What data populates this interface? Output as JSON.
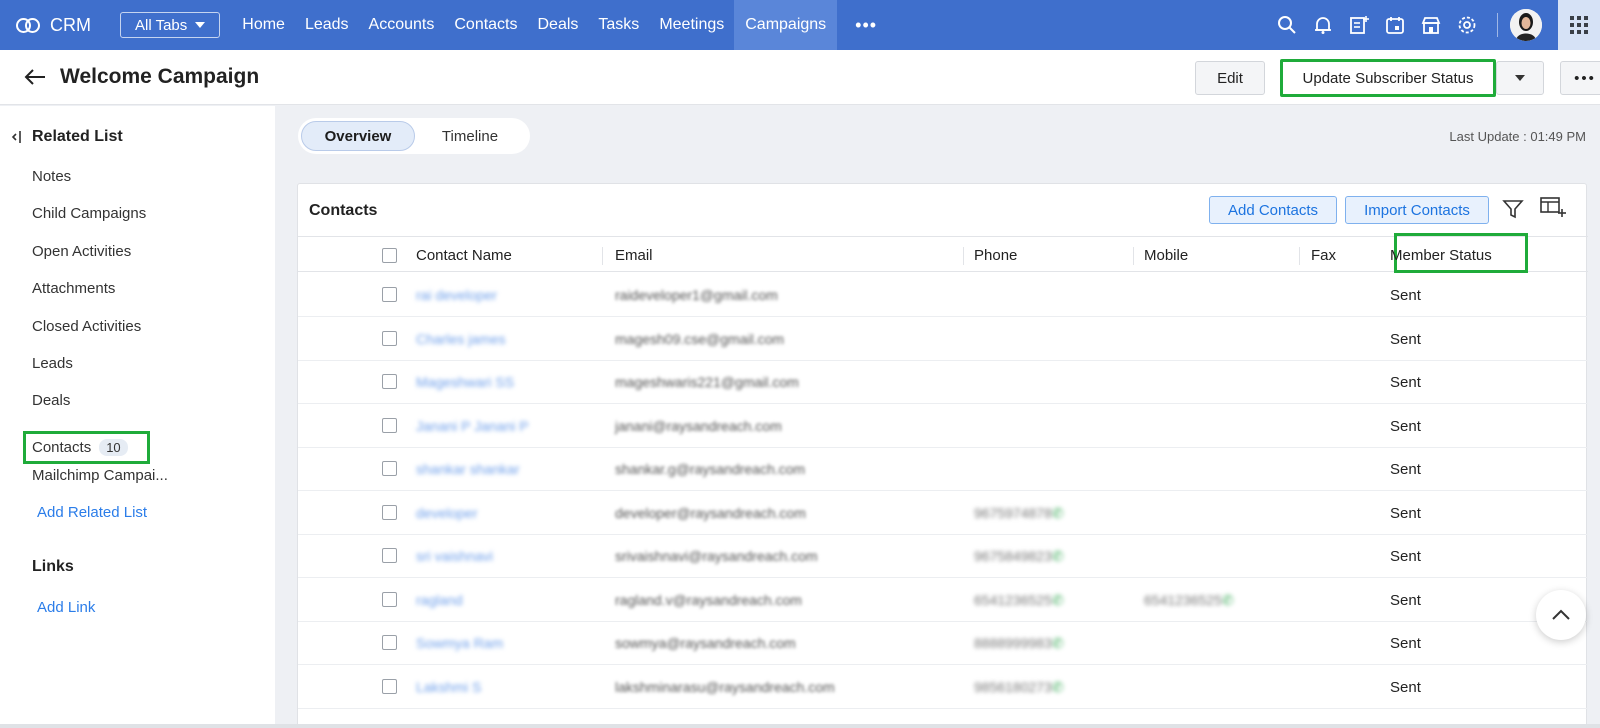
{
  "nav": {
    "brand": "CRM",
    "all_tabs": "All Tabs",
    "tabs": [
      "Home",
      "Leads",
      "Accounts",
      "Contacts",
      "Deals",
      "Tasks",
      "Meetings",
      "Campaigns"
    ],
    "active_tab": "Campaigns",
    "more": "•••"
  },
  "header": {
    "title": "Welcome Campaign",
    "edit": "Edit",
    "update_status": "Update Subscriber Status",
    "more": "•••"
  },
  "sidebar": {
    "related_list": "Related List",
    "items": [
      "Notes",
      "Child Campaigns",
      "Open Activities",
      "Attachments",
      "Closed Activities",
      "Leads",
      "Deals"
    ],
    "contacts_label": "Contacts",
    "contacts_count": "10",
    "mailchimp": "Mailchimp Campai...",
    "add_related": "Add Related List",
    "links_heading": "Links",
    "add_link": "Add Link"
  },
  "main": {
    "overview": "Overview",
    "timeline": "Timeline",
    "last_update": "Last Update : 01:49 PM"
  },
  "contacts_card": {
    "title": "Contacts",
    "add_contacts": "Add Contacts",
    "import_contacts": "Import Contacts",
    "columns": {
      "name": "Contact Name",
      "email": "Email",
      "phone": "Phone",
      "mobile": "Mobile",
      "fax": "Fax",
      "status": "Member Status"
    },
    "rows": [
      {
        "name": "rai developer",
        "email": "raideveloper1@gmail.com",
        "phone": "",
        "mobile": "",
        "status": "Sent"
      },
      {
        "name": "Charles james",
        "email": "magesh09.cse@gmail.com",
        "phone": "",
        "mobile": "",
        "status": "Sent"
      },
      {
        "name": "Mageshwari SS",
        "email": "mageshwaris221@gmail.com",
        "phone": "",
        "mobile": "",
        "status": "Sent"
      },
      {
        "name": "Janani P Janani P",
        "email": "janani@raysandreach.com",
        "phone": "",
        "mobile": "",
        "status": "Sent"
      },
      {
        "name": "shankar shankar",
        "email": "shankar.g@raysandreach.com",
        "phone": "",
        "mobile": "",
        "status": "Sent"
      },
      {
        "name": "developer",
        "email": "developer@raysandreach.com",
        "phone": "9675974878",
        "mobile": "",
        "status": "Sent"
      },
      {
        "name": "sri vaishnavi",
        "email": "srivaishnavi@raysandreach.com",
        "phone": "9675849823",
        "mobile": "",
        "status": "Sent"
      },
      {
        "name": "ragland",
        "email": "ragland.v@raysandreach.com",
        "phone": "6541236525",
        "mobile": "6541236525",
        "status": "Sent"
      },
      {
        "name": "Sowmya Ram",
        "email": "sowmya@raysandreach.com",
        "phone": "8888999983",
        "mobile": "",
        "status": "Sent"
      },
      {
        "name": "Lakshmi S",
        "email": "lakshminarasu@raysandreach.com",
        "phone": "9856180273",
        "mobile": "",
        "status": "Sent"
      }
    ]
  },
  "colors": {
    "nav_bg": "#3f6fcc",
    "highlight": "#1fab3a",
    "link": "#2b7de9"
  }
}
